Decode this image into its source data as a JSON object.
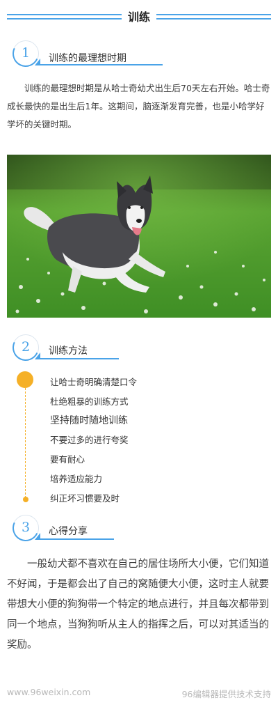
{
  "title": "训练",
  "sections": [
    {
      "number": "1",
      "label": "训练的最理想时期"
    },
    {
      "number": "2",
      "label": "训练方法"
    },
    {
      "number": "3",
      "label": "心得分享"
    }
  ],
  "para1": "训练的最理想时期是从哈士奇幼犬出生后70天左右开始。哈士奇成长最快的是出生后1年。这期间，脑逐渐发育完善，也是小哈学好学坏的关键时期。",
  "methods": [
    "让哈士奇明确清楚口令",
    "杜绝粗暴的训练方式",
    "坚持随时随地训练",
    "不要过多的进行夸奖",
    "要有耐心",
    "培养适应能力",
    "纠正坏习惯要及时"
  ],
  "para3": "一般幼犬都不喜欢在自己的居住场所大小便，它们知道不好闻，于是都会出了自己的窝随便大小便，这时主人就要带想大小便的狗狗带一个特定的地点进行，并且每次都带到同一个地点，当狗狗听从主人的指挥之后，可以对其适当的奖励。",
  "footer": {
    "left": "www.96weixin.com",
    "right": "96编辑器提供技术支持"
  },
  "colors": {
    "accent_blue": "#4aa3e8",
    "accent_orange": "#f5b027"
  },
  "image": {
    "icon": "husky-running-on-grass-photo"
  }
}
